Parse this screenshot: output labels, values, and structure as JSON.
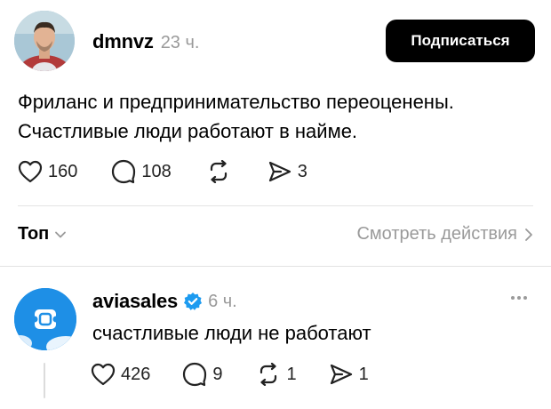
{
  "post": {
    "author": "dmnvz",
    "time": "23 ч.",
    "subscribe_label": "Подписаться",
    "text_lines": [
      "Фриланс и предпринимательство переоценены.",
      "Счастливые люди работают в найме."
    ],
    "likes": "160",
    "comments": "108",
    "shares": "3"
  },
  "sort": {
    "label": "Топ",
    "view_activity": "Смотреть действия"
  },
  "reply": {
    "author": "aviasales",
    "verified": true,
    "time": "6 ч.",
    "text": "счастливые люди не работают",
    "likes": "426",
    "comments": "9",
    "reposts": "1",
    "shares": "1"
  },
  "icons": {
    "like": "heart-icon",
    "comment": "comment-bubble-icon",
    "repost": "repost-icon",
    "share": "send-icon",
    "verified": "verified-badge-icon",
    "more": "more-dots-icon",
    "chevron_down": "chevron-down-icon",
    "chevron_right": "chevron-right-icon"
  },
  "colors": {
    "text": "#000000",
    "muted": "#9a9a9a",
    "verified": "#1d9bf0",
    "reply_avatar": "#1e8fe6",
    "button_bg": "#000000",
    "button_text": "#ffffff"
  }
}
